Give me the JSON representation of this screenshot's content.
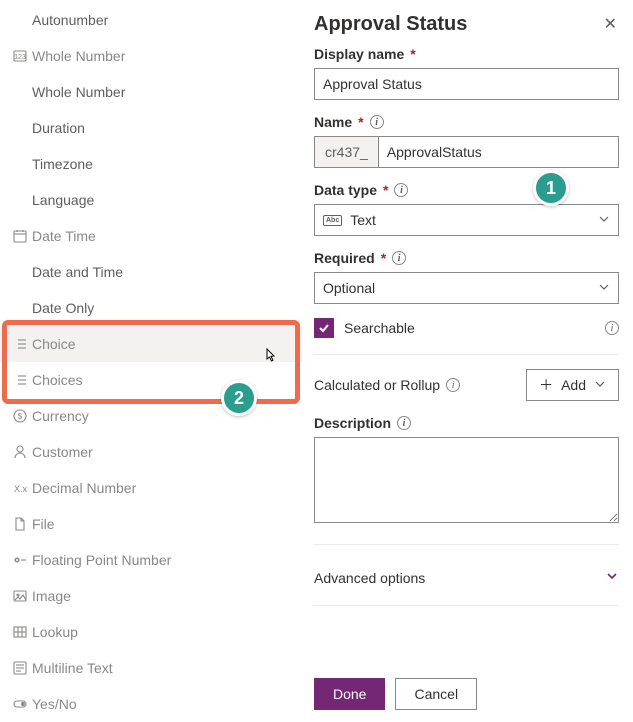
{
  "type_list": {
    "items": [
      {
        "kind": "sub",
        "label": "Autonumber",
        "icon": ""
      },
      {
        "kind": "group",
        "label": "Whole Number",
        "icon": "number"
      },
      {
        "kind": "sub",
        "label": "Whole Number",
        "icon": ""
      },
      {
        "kind": "sub",
        "label": "Duration",
        "icon": ""
      },
      {
        "kind": "sub",
        "label": "Timezone",
        "icon": ""
      },
      {
        "kind": "sub",
        "label": "Language",
        "icon": ""
      },
      {
        "kind": "group",
        "label": "Date Time",
        "icon": "calendar"
      },
      {
        "kind": "sub",
        "label": "Date and Time",
        "icon": ""
      },
      {
        "kind": "sub",
        "label": "Date Only",
        "icon": ""
      },
      {
        "kind": "group",
        "label": "Choice",
        "icon": "list",
        "hovered": true
      },
      {
        "kind": "group",
        "label": "Choices",
        "icon": "list"
      },
      {
        "kind": "group",
        "label": "Currency",
        "icon": "currency"
      },
      {
        "kind": "group",
        "label": "Customer",
        "icon": "person"
      },
      {
        "kind": "group",
        "label": "Decimal Number",
        "icon": "decimal"
      },
      {
        "kind": "group",
        "label": "File",
        "icon": "file"
      },
      {
        "kind": "group",
        "label": "Floating Point Number",
        "icon": "float"
      },
      {
        "kind": "group",
        "label": "Image",
        "icon": "image"
      },
      {
        "kind": "group",
        "label": "Lookup",
        "icon": "lookup"
      },
      {
        "kind": "group",
        "label": "Multiline Text",
        "icon": "multiline"
      },
      {
        "kind": "group",
        "label": "Yes/No",
        "icon": "toggle"
      }
    ]
  },
  "panel": {
    "title": "Approval Status",
    "display_name_label": "Display name",
    "display_name_value": "Approval Status",
    "name_label": "Name",
    "name_prefix": "cr437_",
    "name_value": "ApprovalStatus",
    "data_type_label": "Data type",
    "data_type_value": "Text",
    "required_label": "Required",
    "required_value": "Optional",
    "searchable_label": "Searchable",
    "searchable_checked": true,
    "rollup_label": "Calculated or Rollup",
    "add_label": "Add",
    "description_label": "Description",
    "description_value": "",
    "advanced_label": "Advanced options",
    "done_label": "Done",
    "cancel_label": "Cancel"
  },
  "callouts": {
    "badge1": "1",
    "badge2": "2"
  }
}
